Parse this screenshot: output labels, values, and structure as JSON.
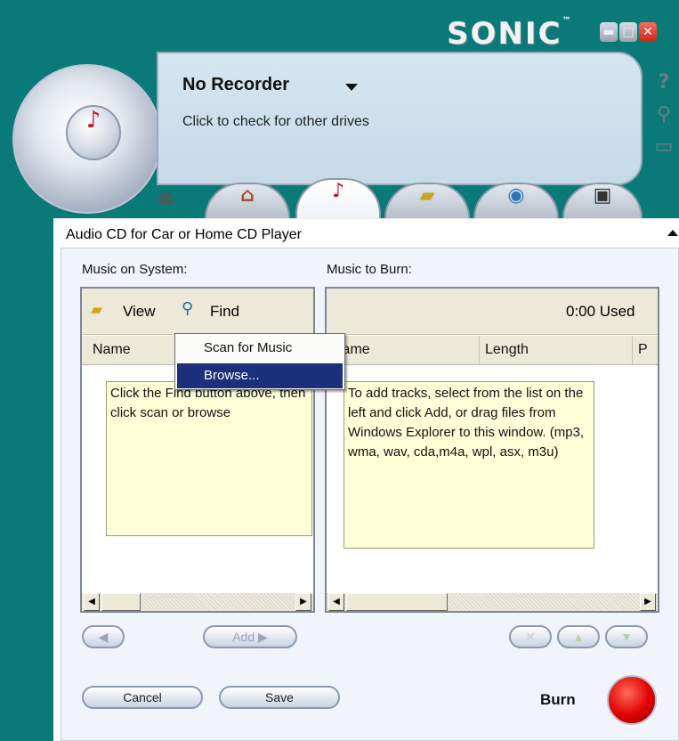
{
  "app": {
    "logo": "SONIC",
    "logo_tm": "™",
    "window_controls": [
      "minimize",
      "maximize",
      "close"
    ]
  },
  "side_icons": [
    "help-icon",
    "tools-icon",
    "folder-icon"
  ],
  "recorder": {
    "title": "No Recorder",
    "subtitle": "Click to check for other drives"
  },
  "tabs": [
    {
      "name": "home",
      "icon": "home-icon",
      "active": false
    },
    {
      "name": "audio",
      "icon": "music-note-icon",
      "active": true
    },
    {
      "name": "data",
      "icon": "folder-icon",
      "active": false
    },
    {
      "name": "copy",
      "icon": "disc-copy-icon",
      "active": false
    },
    {
      "name": "video",
      "icon": "camera-icon",
      "active": false
    }
  ],
  "project": {
    "title": "Audio CD for Car or Home CD Player"
  },
  "left": {
    "label": "Music on System:",
    "view": "View",
    "find": "Find",
    "col_name": "Name",
    "hint": "Click the Find button above, then click scan or browse"
  },
  "right": {
    "label": "Music to Burn:",
    "used": "0:00 Used",
    "columns": [
      "Name",
      "Length",
      "P"
    ],
    "hint": "To add tracks, select from the list on the left and click Add, or drag files from Windows Explorer to this window. (mp3, wma, wav, cda,m4a, wpl, asx, m3u)"
  },
  "menu": {
    "items": [
      "Scan for Music",
      "Browse..."
    ],
    "selected": 1
  },
  "buttons": {
    "back": "",
    "add": "Add",
    "cancel": "Cancel",
    "save": "Save",
    "burn": "Burn"
  },
  "colors": {
    "background": "#0a7a78",
    "menu_highlight": "#1c2f7a",
    "burn": "#e00000"
  }
}
